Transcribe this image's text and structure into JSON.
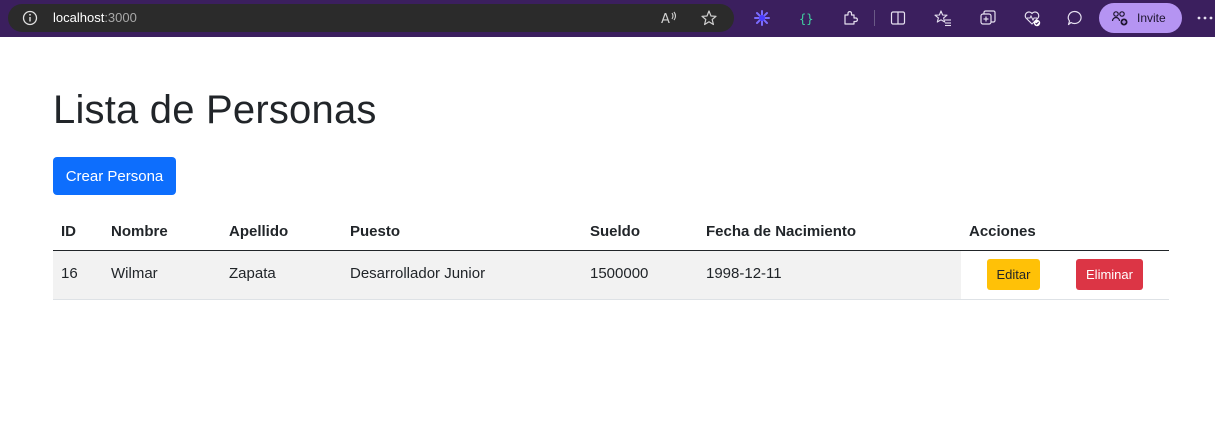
{
  "browser": {
    "url_host": "localhost",
    "url_port": ":3000",
    "invite_label": "Invite",
    "accent_color": "#3b1f5e",
    "toolbar_icons": [
      "read-aloud-icon",
      "favorite-star-icon",
      "copilot-icon",
      "devtools-braces-icon",
      "extensions-icon",
      "split-screen-icon",
      "favorites-icon",
      "collections-icon",
      "performance-heart-icon",
      "feedback-icon",
      "more-icon"
    ]
  },
  "page": {
    "title": "Lista de Personas",
    "create_button": "Crear Persona"
  },
  "table": {
    "headers": {
      "id": "ID",
      "nombre": "Nombre",
      "apellido": "Apellido",
      "puesto": "Puesto",
      "sueldo": "Sueldo",
      "fecha": "Fecha de Nacimiento",
      "acciones": "Acciones"
    },
    "rows": [
      {
        "id": "16",
        "nombre": "Wilmar",
        "apellido": "Zapata",
        "puesto": "Desarrollador Junior",
        "sueldo": "1500000",
        "fecha": "1998-12-11",
        "edit_label": "Editar",
        "delete_label": "Eliminar"
      }
    ]
  },
  "colors": {
    "primary": "#0d6efd",
    "warning": "#ffc107",
    "danger": "#dc3545"
  }
}
